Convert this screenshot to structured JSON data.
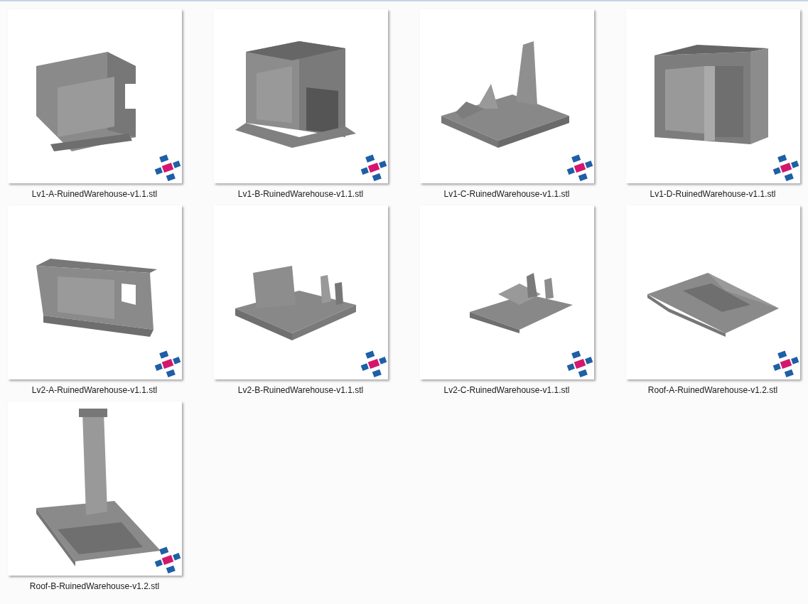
{
  "files": [
    {
      "name": "Lv1-A-RuinedWarehouse-v1.1.stl",
      "kind": "picture"
    },
    {
      "name": "Lv1-B-RuinedWarehouse-v1.1.stl",
      "kind": "picture"
    },
    {
      "name": "Lv1-C-RuinedWarehouse-v1.1.stl",
      "kind": "picture"
    },
    {
      "name": "Lv1-D-RuinedWarehouse-v1.1.stl",
      "kind": "picture"
    },
    {
      "name": "Lv2-A-RuinedWarehouse-v1.1.stl",
      "kind": "picture"
    },
    {
      "name": "Lv2-B-RuinedWarehouse-v1.1.stl",
      "kind": "picture"
    },
    {
      "name": "Lv2-C-RuinedWarehouse-v1.1.stl",
      "kind": "picture"
    },
    {
      "name": "Roof-A-RuinedWarehouse-v1.2.stl",
      "kind": "picture"
    },
    {
      "name": "Roof-B-RuinedWarehouse-v1.2.stl",
      "kind": "picture"
    }
  ]
}
